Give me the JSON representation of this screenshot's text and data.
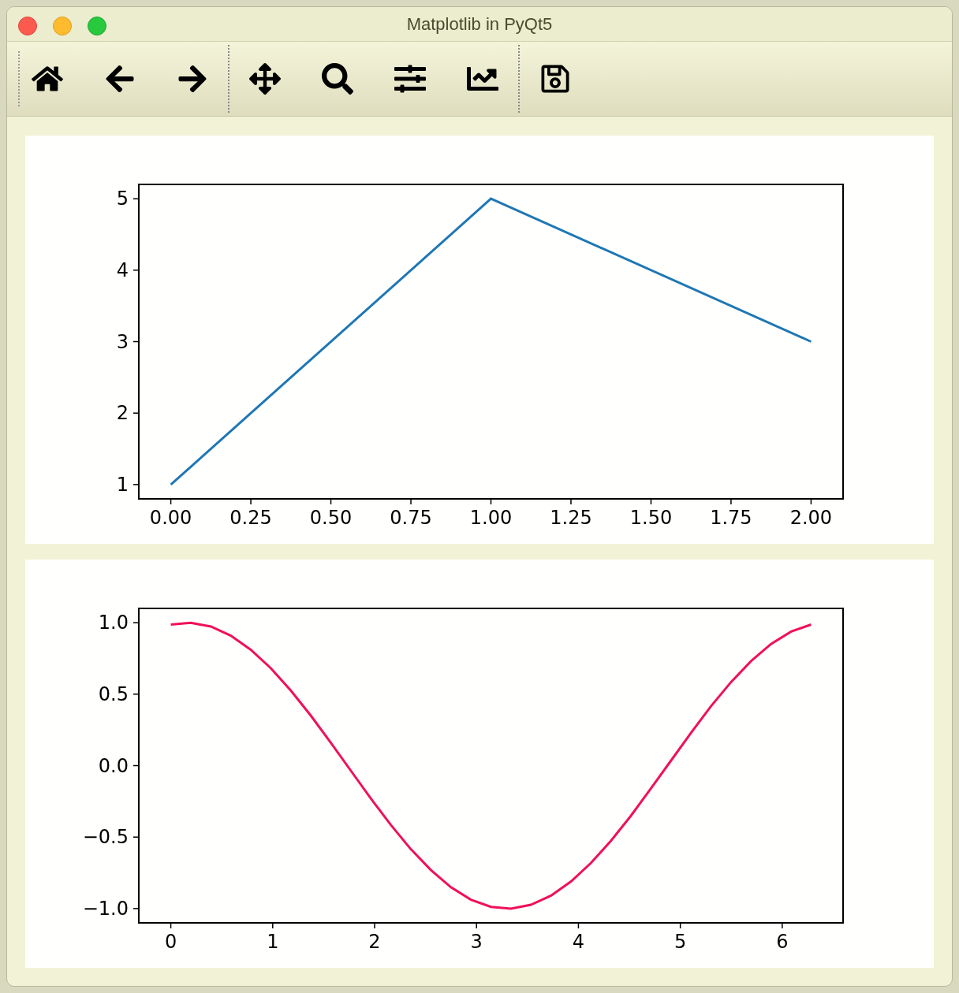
{
  "window": {
    "title": "Matplotlib in PyQt5"
  },
  "plots": [
    {
      "chart_data": {
        "type": "line",
        "x": [
          0,
          1,
          2
        ],
        "series": [
          {
            "color": "#1f77b4",
            "values": [
              1,
              5,
              3
            ]
          }
        ],
        "xlim": [
          -0.1,
          2.1
        ],
        "ylim": [
          0.8,
          5.2
        ],
        "xticks": [
          {
            "value": 0,
            "label": "0.00"
          },
          {
            "value": 0.25,
            "label": "0.25"
          },
          {
            "value": 0.5,
            "label": "0.50"
          },
          {
            "value": 0.75,
            "label": "0.75"
          },
          {
            "value": 1,
            "label": "1.00"
          },
          {
            "value": 1.25,
            "label": "1.25"
          },
          {
            "value": 1.5,
            "label": "1.50"
          },
          {
            "value": 1.75,
            "label": "1.75"
          },
          {
            "value": 2,
            "label": "2.00"
          }
        ],
        "yticks": [
          1,
          2,
          3,
          4,
          5
        ]
      }
    },
    {
      "chart_data": {
        "type": "line",
        "x": [
          0,
          0.196,
          0.393,
          0.589,
          0.785,
          0.982,
          1.178,
          1.374,
          1.571,
          1.767,
          1.963,
          2.16,
          2.356,
          2.553,
          2.749,
          2.945,
          3.142,
          3.338,
          3.534,
          3.731,
          3.927,
          4.123,
          4.32,
          4.516,
          4.712,
          4.909,
          5.105,
          5.301,
          5.498,
          5.694,
          5.89,
          6.087,
          6.283
        ],
        "series": [
          {
            "color": "#f0105a",
            "values": [
              0.987,
              0.999,
              0.973,
              0.909,
              0.811,
              0.681,
              0.525,
              0.35,
              0.159,
              -0.036,
              -0.23,
              -0.416,
              -0.585,
              -0.731,
              -0.851,
              -0.938,
              -0.988,
              -1,
              -0.973,
              -0.909,
              -0.811,
              -0.681,
              -0.525,
              -0.35,
              -0.159,
              0.036,
              0.23,
              0.416,
              0.585,
              0.731,
              0.851,
              0.938,
              0.987
            ]
          }
        ],
        "xlim": [
          -0.314,
          6.597
        ],
        "ylim": [
          -1.1,
          1.1
        ],
        "xticks": [
          0,
          1,
          2,
          3,
          4,
          5,
          6
        ],
        "yticks": [
          {
            "value": 1,
            "label": "1.0"
          },
          {
            "value": 0.5,
            "label": "0.5"
          },
          {
            "value": 0,
            "label": "0.0"
          },
          {
            "value": -0.5,
            "label": "−0.5"
          },
          {
            "value": -1,
            "label": "−1.0"
          }
        ]
      }
    }
  ]
}
